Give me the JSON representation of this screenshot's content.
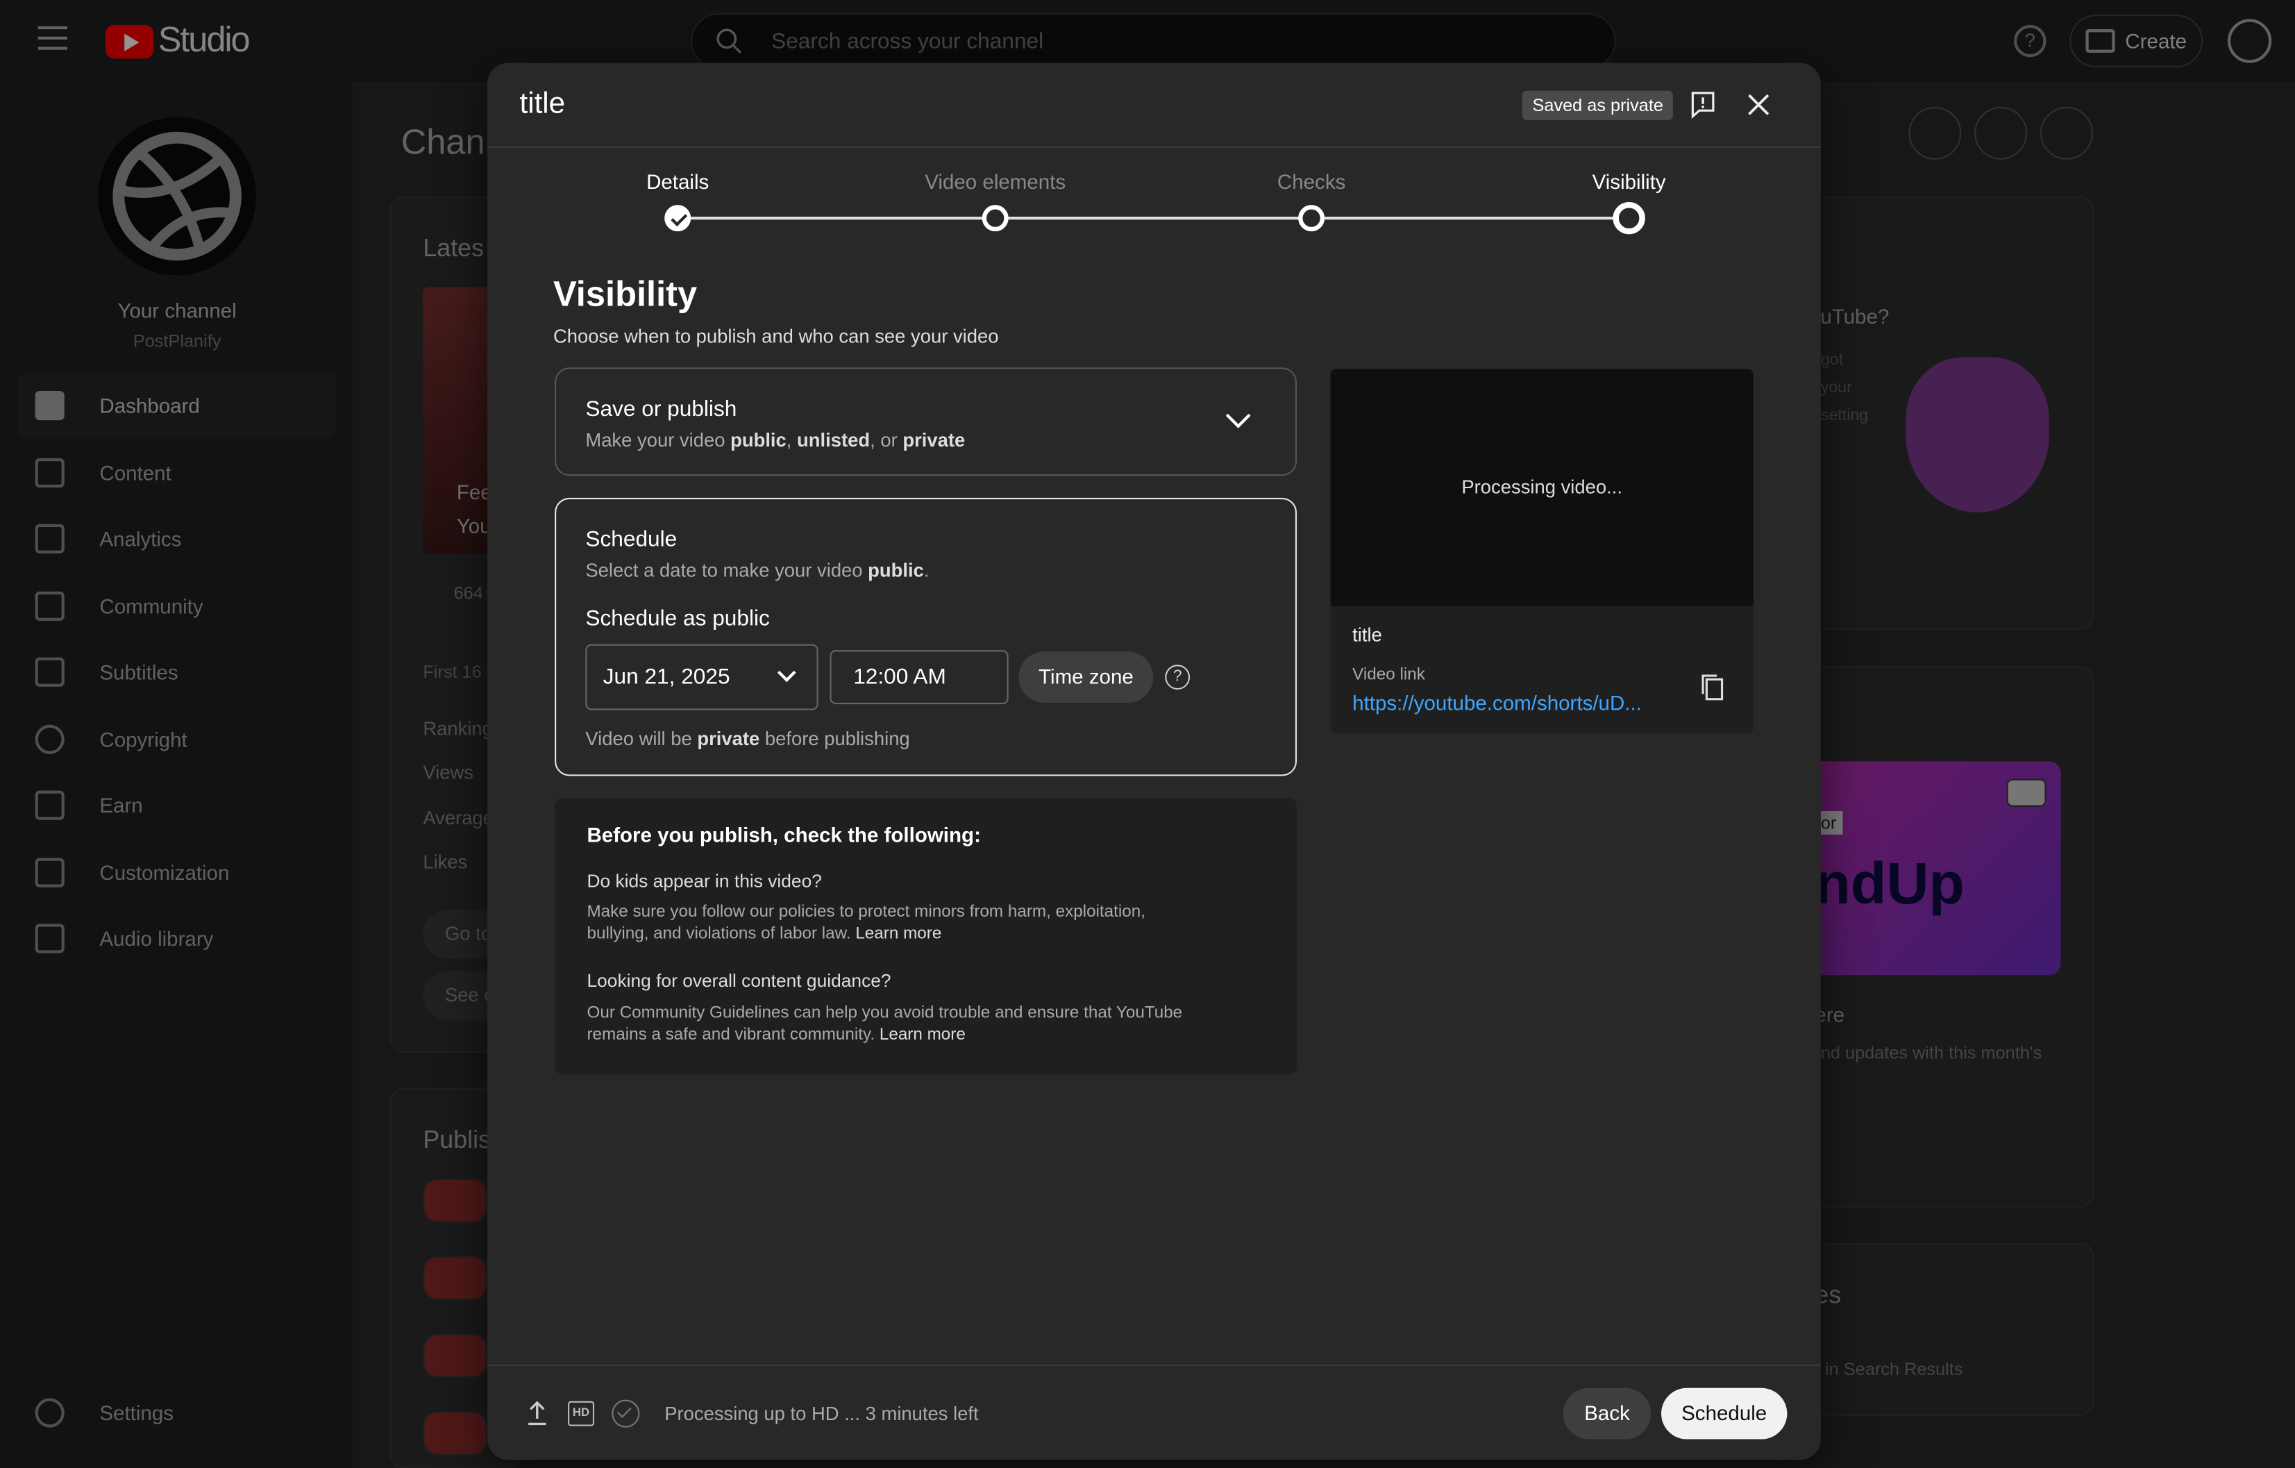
{
  "app": {
    "brand": "Studio",
    "search_placeholder": "Search across your channel",
    "create_label": "Create"
  },
  "sidebar": {
    "channel_name": "Your channel",
    "channel_handle": "PostPlanify",
    "items": [
      {
        "label": "Dashboard",
        "icon": "dashboard-icon",
        "active": true
      },
      {
        "label": "Content",
        "icon": "content-icon"
      },
      {
        "label": "Analytics",
        "icon": "analytics-icon"
      },
      {
        "label": "Community",
        "icon": "community-icon"
      },
      {
        "label": "Subtitles",
        "icon": "subtitles-icon"
      },
      {
        "label": "Copyright",
        "icon": "copyright-icon"
      },
      {
        "label": "Earn",
        "icon": "earn-icon"
      },
      {
        "label": "Customization",
        "icon": "customization-icon"
      },
      {
        "label": "Audio library",
        "icon": "audio-library-icon"
      }
    ],
    "settings_label": "Settings"
  },
  "background": {
    "page_title": "Chann",
    "latest_label": "Lates",
    "thumb_line1": "Fee",
    "thumb_line2": "You",
    "views_stat": "664",
    "first_label": "First 16",
    "ranking": "Ranking",
    "views": "Views",
    "average": "Average",
    "likes": "Likes",
    "goto_btn": "Go to",
    "see_btn": "See c",
    "published_label": "Publis",
    "right_card_title": "ouTube?",
    "right_card_l1": "got",
    "right_card_l2": "your",
    "right_card_l3": "setting",
    "banner_text": "ndUp",
    "banner_tag": "or",
    "news_title": "ere",
    "news_sub": "nd updates with this month's",
    "bottom_title": "es",
    "bottom_sub": "in Search Results"
  },
  "dialog": {
    "title": "title",
    "saved_badge": "Saved as private",
    "steps": [
      {
        "label": "Details",
        "state": "done"
      },
      {
        "label": "Video elements",
        "state": "pending"
      },
      {
        "label": "Checks",
        "state": "pending"
      },
      {
        "label": "Visibility",
        "state": "current"
      }
    ],
    "section_title": "Visibility",
    "section_sub": "Choose when to publish and who can see your video",
    "save_publish": {
      "title": "Save or publish",
      "sub_prefix": "Make your video ",
      "opt_public": "public",
      "sep1": ", ",
      "opt_unlisted": "unlisted",
      "sep2": ", or ",
      "opt_private": "private"
    },
    "schedule": {
      "title": "Schedule",
      "sub_prefix": "Select a date to make your video ",
      "sub_bold": "public",
      "sub_suffix": ".",
      "schedule_as": "Schedule as public",
      "date": "Jun 21, 2025",
      "time": "12:00 AM",
      "timezone_btn": "Time zone",
      "note_prefix": "Video will be ",
      "note_bold": "private",
      "note_suffix": " before publishing"
    },
    "checks": {
      "title": "Before you publish, check the following:",
      "q1": "Do kids appear in this video?",
      "p1": "Make sure you follow our policies to protect minors from harm, exploitation, bullying, and violations of labor law.",
      "q2": "Looking for overall content guidance?",
      "p2": "Our Community Guidelines can help you avoid trouble and ensure that YouTube remains a safe and vibrant community.",
      "learn_more": "Learn more"
    },
    "preview": {
      "processing": "Processing video...",
      "title": "title",
      "link_label": "Video link",
      "link_url": "https://youtube.com/shorts/uD..."
    },
    "footer": {
      "hd_label": "HD",
      "status": "Processing up to HD ... 3 minutes left",
      "back": "Back",
      "schedule": "Schedule"
    }
  },
  "colors": {
    "brand_red": "#ff0000",
    "link_blue": "#3ea6ff",
    "dialog_bg": "#282828"
  }
}
